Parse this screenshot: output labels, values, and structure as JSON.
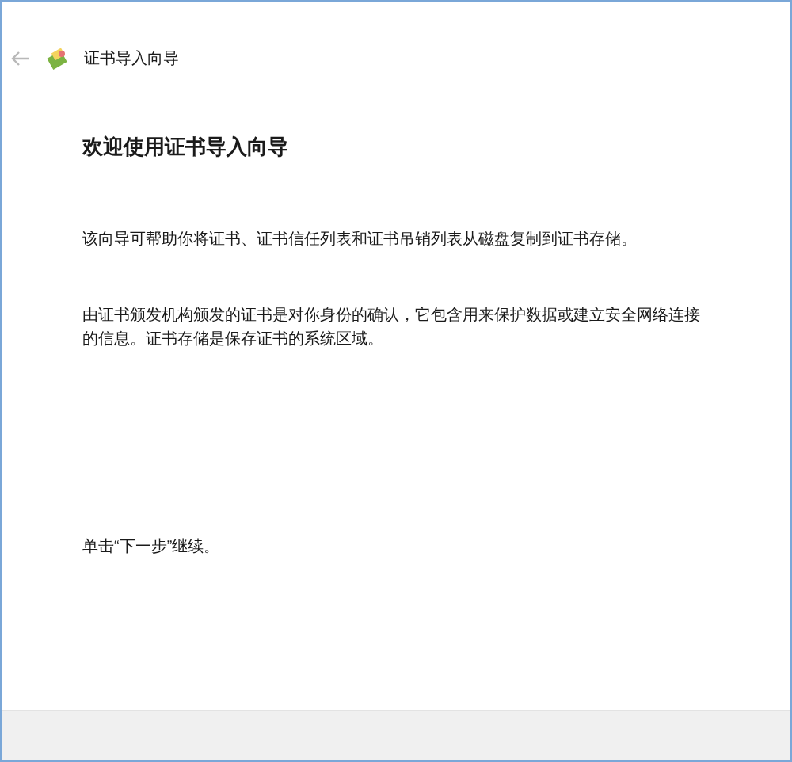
{
  "window": {
    "title": "证书导入向导"
  },
  "heading": "欢迎使用证书导入向导",
  "paragraphs": [
    "该向导可帮助你将证书、证书信任列表和证书吊销列表从磁盘复制到证书存储。",
    "由证书颁发机构颁发的证书是对你身份的确认，它包含用来保护数据或建立安全网络连接的信息。证书存储是保存证书的系统区域。"
  ],
  "instruction": "单击“下一步”继续。"
}
